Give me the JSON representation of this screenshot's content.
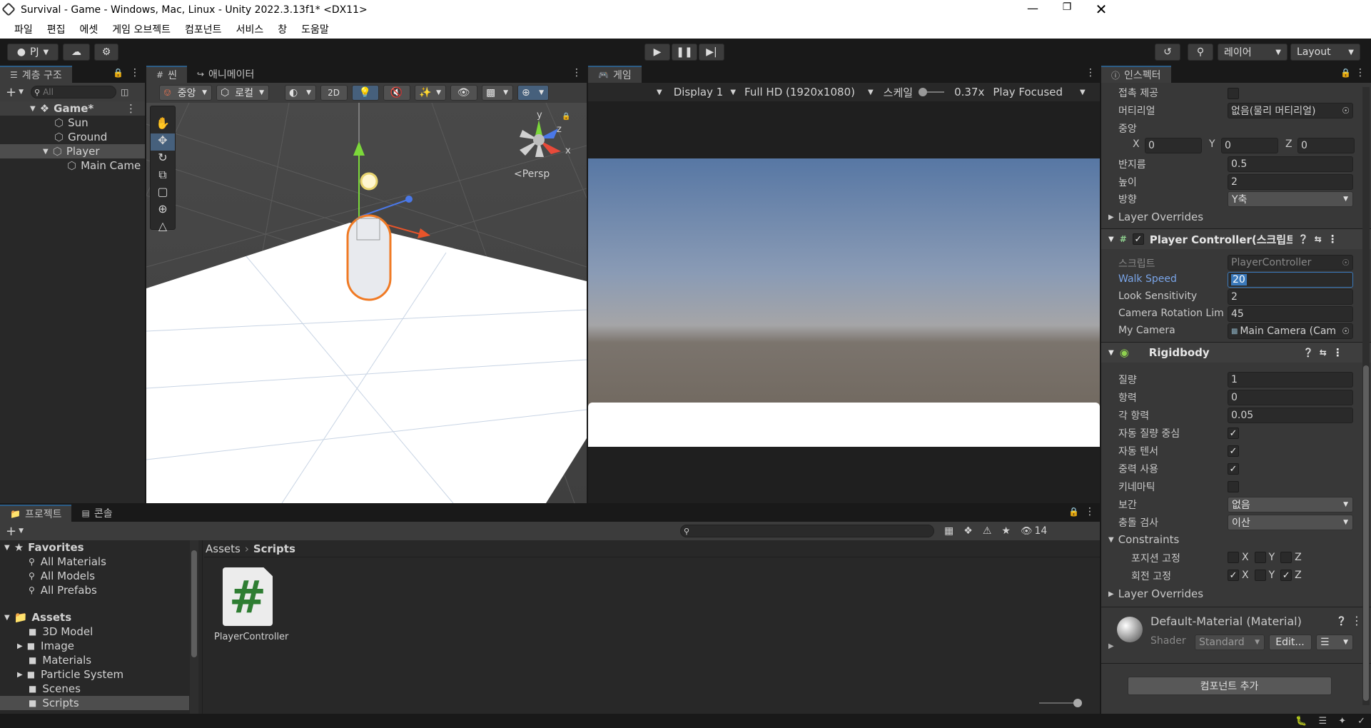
{
  "window": {
    "title": "Survival - Game - Windows, Mac, Linux - Unity 2022.3.13f1* <DX11>"
  },
  "menu": [
    "파일",
    "편집",
    "에셋",
    "게임 오브젝트",
    "컴포넌트",
    "서비스",
    "창",
    "도움말"
  ],
  "toolbar": {
    "account": "PJ",
    "layers": "레이어",
    "layout": "Layout"
  },
  "hierarchy": {
    "tab": "계층 구조",
    "search_placeholder": "All",
    "scene": "Game*",
    "items": [
      "Sun",
      "Ground",
      "Player",
      "Main Came"
    ]
  },
  "scene_view": {
    "tab_scene": "씬",
    "tab_animator": "애니메이터",
    "pivot": "중앙",
    "space": "로컬",
    "mode_2d": "2D",
    "persp": "Persp",
    "axis_y": "y",
    "axis_z": "z",
    "axis_x": "x"
  },
  "game_view": {
    "tab": "게임",
    "display": "Display 1",
    "resolution": "Full HD (1920x1080)",
    "scale_label": "스케일",
    "scale_value": "0.37x",
    "play_mode": "Play Focused"
  },
  "inspector": {
    "tab": "인스펙터",
    "capsule": [
      {
        "label": "접촉 제공",
        "type": "check",
        "checked": false
      },
      {
        "label": "머티리얼",
        "type": "object",
        "value": "없음(물리 머티리얼)"
      },
      {
        "label": "중앙",
        "type": "header"
      },
      {
        "label": "반지름",
        "type": "field",
        "value": "0.5"
      },
      {
        "label": "높이",
        "type": "field",
        "value": "2"
      },
      {
        "label": "방향",
        "type": "drop",
        "value": "Y축"
      }
    ],
    "center": {
      "x_label": "X",
      "x": "0",
      "y_label": "Y",
      "y": "0",
      "z_label": "Z",
      "z": "0"
    },
    "layer_overrides": "Layer Overrides",
    "player_controller": {
      "title": "Player Controller(스크립트",
      "script_label": "스크립트",
      "script_value": "PlayerController",
      "walk_speed_label": "Walk Speed",
      "walk_speed": "20",
      "look_label": "Look Sensitivity",
      "look": "2",
      "cam_rot_label": "Camera Rotation Lim",
      "cam_rot": "45",
      "my_camera_label": "My Camera",
      "my_camera": "Main Camera (Cam"
    },
    "rigidbody": {
      "title": "Rigidbody",
      "mass_label": "질량",
      "mass": "1",
      "drag_label": "항력",
      "drag": "0",
      "angular_label": "각 항력",
      "angular": "0.05",
      "auto_com_label": "자동 질량 중심",
      "auto_tensor_label": "자동 텐서",
      "gravity_label": "중력 사용",
      "kinematic_label": "키네마틱",
      "interp_label": "보간",
      "interp": "없음",
      "collision_label": "충돌 검사",
      "collision": "이산",
      "constraints": "Constraints",
      "freeze_pos": "포지션 고정",
      "freeze_rot": "회전 고정",
      "x": "X",
      "y": "Y",
      "z": "Z"
    },
    "material": {
      "name": "Default-Material (Material)",
      "shader_label": "Shader",
      "shader": "Standard",
      "edit": "Edit..."
    },
    "add_component": "컴포넌트 추가"
  },
  "project": {
    "tab_project": "프로젝트",
    "tab_console": "콘솔",
    "hidden_count": "14",
    "favorites": "Favorites",
    "fav_items": [
      "All Materials",
      "All Models",
      "All Prefabs"
    ],
    "assets": "Assets",
    "asset_folders": [
      "3D Model",
      "Image",
      "Materials",
      "Particle System",
      "Scenes",
      "Scripts"
    ],
    "breadcrumb_root": "Assets",
    "breadcrumb_current": "Scripts",
    "file_name": "PlayerController",
    "file_glyph": "#"
  },
  "colors": {
    "accent": "#2c5d87",
    "selection": "#2c5d87",
    "script_green": "#2e7d32"
  }
}
